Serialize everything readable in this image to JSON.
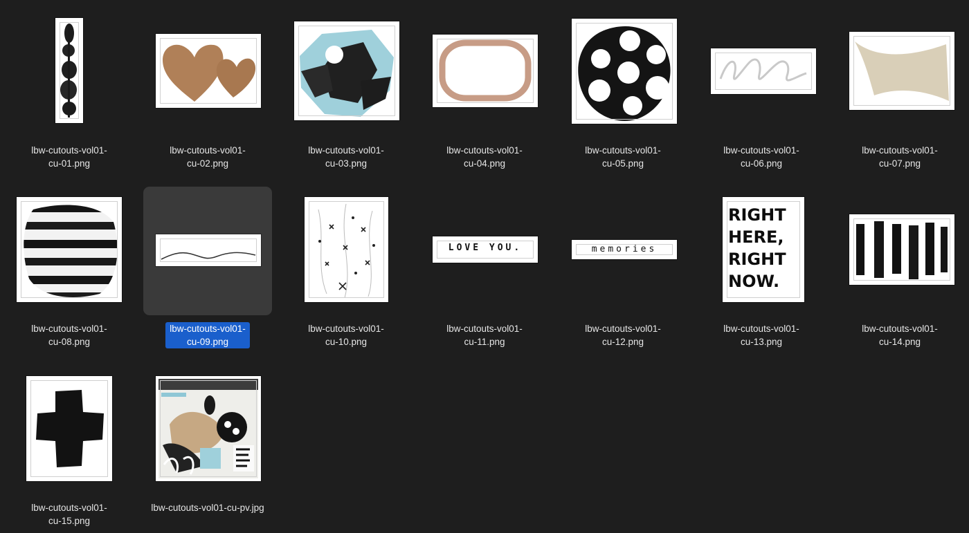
{
  "window": {
    "view": "icon-grid",
    "background": "#1e1e1e",
    "selection_color": "#1a5fcc"
  },
  "files": [
    {
      "line1": "lbw-cutouts-vol01-",
      "line2": "cu-01.png",
      "icon": "pebble-stack-thumbnail",
      "selected": false
    },
    {
      "line1": "lbw-cutouts-vol01-",
      "line2": "cu-02.png",
      "icon": "hearts-thumbnail",
      "selected": false
    },
    {
      "line1": "lbw-cutouts-vol01-",
      "line2": "cu-03.png",
      "icon": "blue-octagon-thumbnail",
      "selected": false
    },
    {
      "line1": "lbw-cutouts-vol01-",
      "line2": "cu-04.png",
      "icon": "frame-thumbnail",
      "selected": false
    },
    {
      "line1": "lbw-cutouts-vol01-",
      "line2": "cu-05.png",
      "icon": "polka-dot-circle-thumbnail",
      "selected": false
    },
    {
      "line1": "lbw-cutouts-vol01-",
      "line2": "cu-06.png",
      "icon": "loops-thumbnail",
      "selected": false
    },
    {
      "line1": "lbw-cutouts-vol01-",
      "line2": "cu-07.png",
      "icon": "paper-strip-thumbnail",
      "selected": false
    },
    {
      "line1": "lbw-cutouts-vol01-",
      "line2": "cu-08.png",
      "icon": "striped-ring-thumbnail",
      "selected": false
    },
    {
      "line1": "lbw-cutouts-vol01-",
      "line2": "cu-09.png",
      "icon": "wavy-line-thumbnail",
      "selected": true
    },
    {
      "line1": "lbw-cutouts-vol01-",
      "line2": "cu-10.png",
      "icon": "doodle-thumbnail",
      "selected": false
    },
    {
      "line1": "lbw-cutouts-vol01-",
      "line2": "cu-11.png",
      "icon": "love-you-thumbnail",
      "selected": false,
      "art_text": "LOVE YOU."
    },
    {
      "line1": "lbw-cutouts-vol01-",
      "line2": "cu-12.png",
      "icon": "memories-thumbnail",
      "selected": false,
      "art_text": "memories"
    },
    {
      "line1": "lbw-cutouts-vol01-",
      "line2": "cu-13.png",
      "icon": "right-here-thumbnail",
      "selected": false,
      "art_text": "RIGHT HERE, RIGHT NOW."
    },
    {
      "line1": "lbw-cutouts-vol01-",
      "line2": "cu-14.png",
      "icon": "brush-bars-thumbnail",
      "selected": false
    },
    {
      "line1": "lbw-cutouts-vol01-",
      "line2": "cu-15.png",
      "icon": "black-cross-thumbnail",
      "selected": false
    },
    {
      "line1": "lbw-cutouts-vol01-cu-pv.jpg",
      "line2": "",
      "icon": "preview-collage-thumbnail",
      "selected": false
    }
  ]
}
